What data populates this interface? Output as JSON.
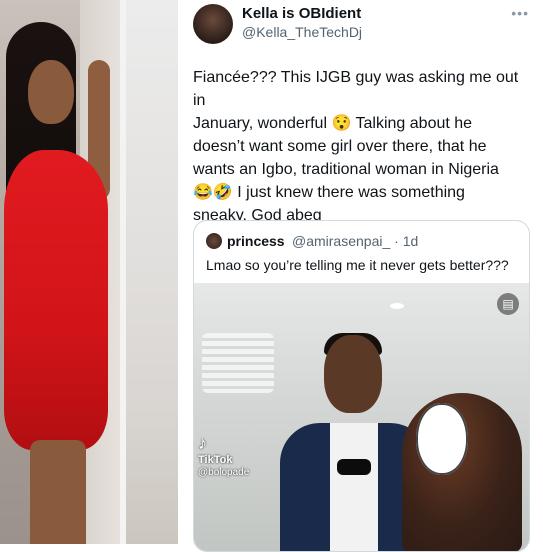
{
  "tweet": {
    "display_name": "Kella is OBIdient",
    "handle": "@Kella_TheTechDj",
    "more_icon": "more-horizontal-icon",
    "text_lines": [
      "Fiancée??? This IJGB guy was asking me out in",
      "January, wonderful 😯 Talking about he",
      "doesn’t want some girl over there, that he",
      "wants an Igbo, traditional woman in Nigeria",
      "😂🤣 I just knew there was something",
      "sneaky, God abeg"
    ]
  },
  "quoted": {
    "name": "princess",
    "handle": "@amirasenpai_ · 1d",
    "text": "Lmao so you’re telling me it never gets better???",
    "media": {
      "watermark_brand": "TikTok",
      "watermark_user": "@bolopade"
    }
  }
}
